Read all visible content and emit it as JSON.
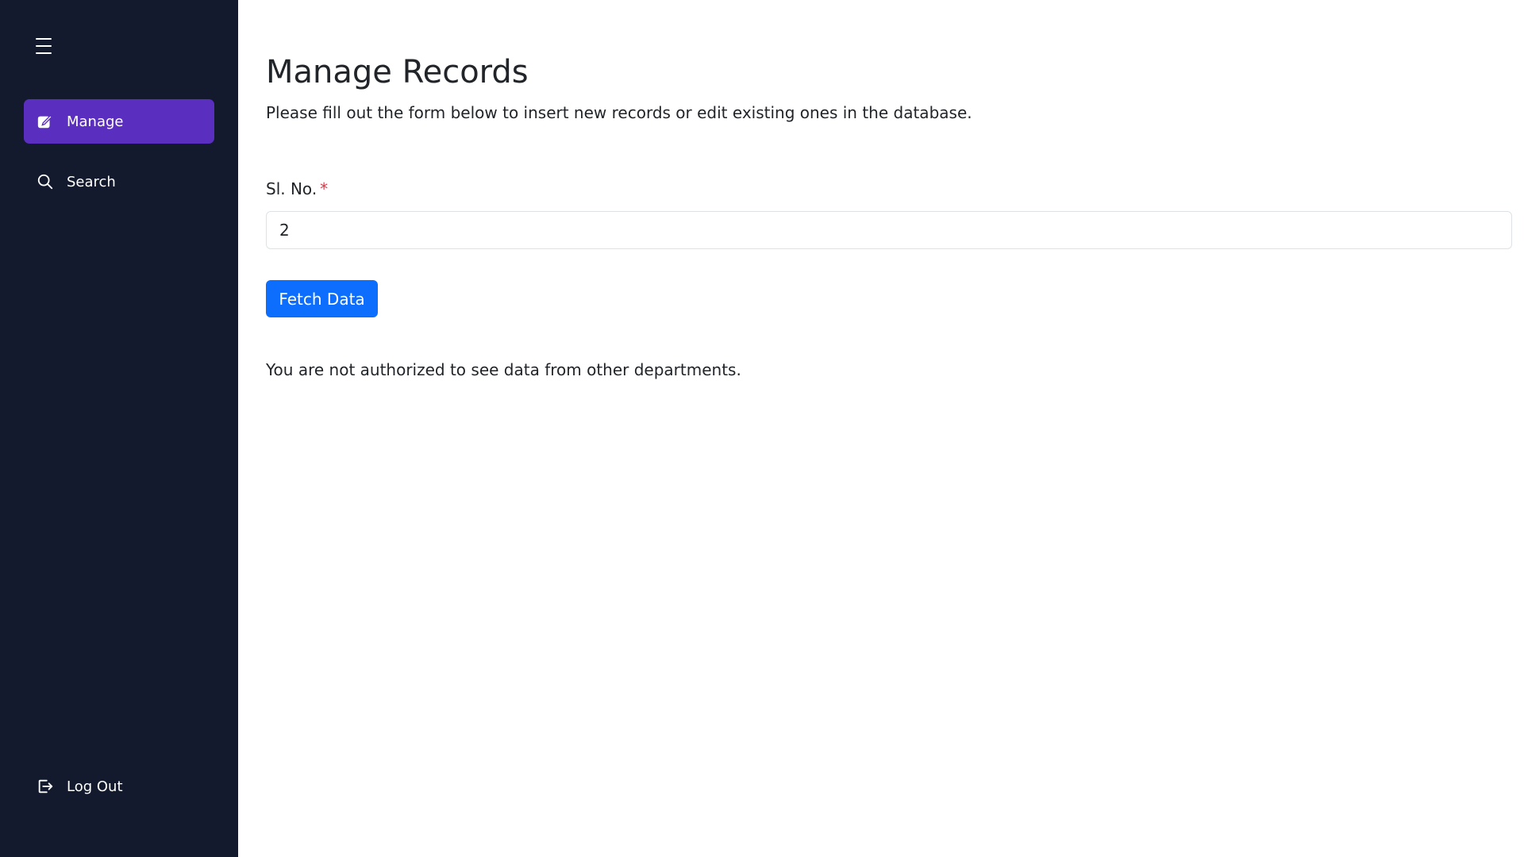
{
  "sidebar": {
    "menu_icon": "hamburger-menu-icon",
    "items": [
      {
        "label": "Manage",
        "icon": "edit-square-icon",
        "active": true
      },
      {
        "label": "Search",
        "icon": "search-icon",
        "active": false
      }
    ],
    "logout": {
      "label": "Log Out",
      "icon": "logout-icon"
    },
    "colors": {
      "background": "#141a2e",
      "active": "#5a2fc0"
    }
  },
  "main": {
    "title": "Manage Records",
    "subtitle": "Please fill out the form below to insert new records or edit existing ones in the database.",
    "form": {
      "field_label": "Sl. No.",
      "required_marker": "*",
      "field_value": "2",
      "button_label": "Fetch Data"
    },
    "message": "You are not authorized to see data from other departments.",
    "colors": {
      "primary": "#0d6efd",
      "required": "#dc3545"
    }
  }
}
